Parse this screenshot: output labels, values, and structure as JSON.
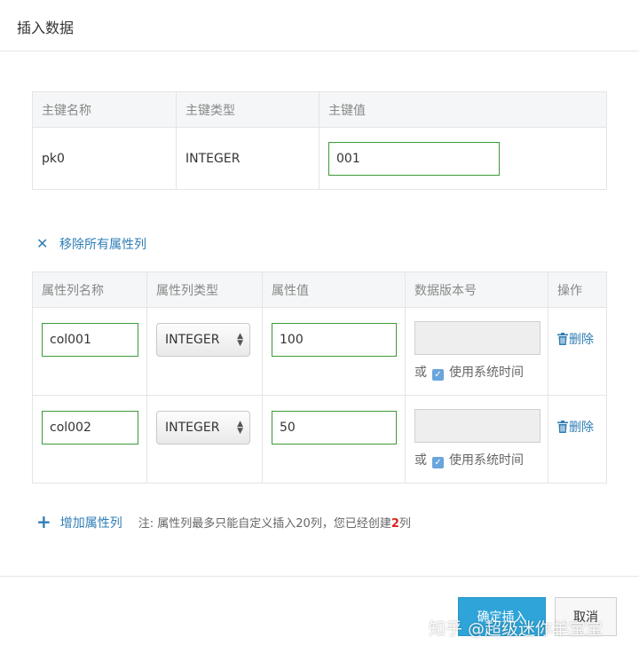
{
  "dialog": {
    "title": "插入数据"
  },
  "primary_key_table": {
    "headers": [
      "主键名称",
      "主键类型",
      "主键值"
    ],
    "row": {
      "name": "pk0",
      "type": "INTEGER",
      "value": "001"
    }
  },
  "remove_all": {
    "icon": "close-icon",
    "label": "移除所有属性列"
  },
  "attribute_table": {
    "headers": [
      "属性列名称",
      "属性列类型",
      "属性值",
      "数据版本号",
      "操作"
    ],
    "rows": [
      {
        "name": "col001",
        "type": "INTEGER",
        "value": "100",
        "version": "",
        "or_label": "或",
        "use_system_time": true,
        "use_system_time_label": "使用系统时间",
        "delete_label": "删除"
      },
      {
        "name": "col002",
        "type": "INTEGER",
        "value": "50",
        "version": "",
        "or_label": "或",
        "use_system_time": true,
        "use_system_time_label": "使用系统时间",
        "delete_label": "删除"
      }
    ]
  },
  "add_attribute": {
    "label": "增加属性列",
    "note_prefix": "注: 属性列最多只能自定义插入20列，您已经创建",
    "note_count": "2",
    "note_suffix": "列"
  },
  "footer": {
    "confirm_label": "确定插入",
    "cancel_label": "取消"
  },
  "watermark": "知乎 @超级迷你羊宝宝",
  "colors": {
    "accent": "#2f7eb5",
    "primary_button": "#2ea4d8",
    "input_border": "#3c9a37",
    "count_highlight": "#d9241f"
  }
}
